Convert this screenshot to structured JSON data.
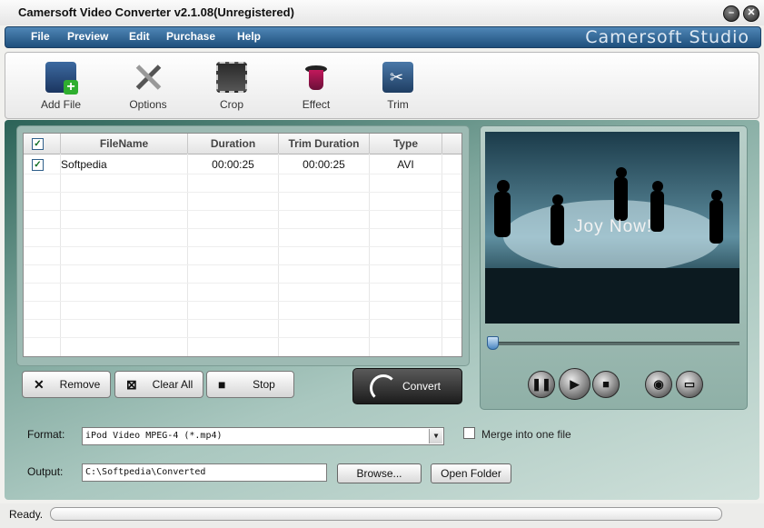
{
  "window": {
    "title": "Camersoft Video Converter v2.1.08(Unregistered)",
    "brand": "Camersoft Studio"
  },
  "menu": [
    "File",
    "Preview",
    "Edit",
    "Purchase",
    "Help"
  ],
  "toolbar": [
    {
      "label": "Add File",
      "icon": "film-add-icon"
    },
    {
      "label": "Options",
      "icon": "tools-icon"
    },
    {
      "label": "Crop",
      "icon": "crop-film-icon"
    },
    {
      "label": "Effect",
      "icon": "magic-hat-icon"
    },
    {
      "label": "Trim",
      "icon": "scissors-film-icon"
    }
  ],
  "filelist": {
    "columns": [
      "FileName",
      "Duration",
      "Trim Duration",
      "Type"
    ],
    "header_checked": true,
    "rows": [
      {
        "checked": true,
        "name": "Softpedia",
        "duration": "00:00:25",
        "trim": "00:00:25",
        "type": "AVI"
      }
    ]
  },
  "buttons": {
    "remove": "Remove",
    "clear_all": "Clear All",
    "stop": "Stop",
    "convert": "Convert"
  },
  "preview": {
    "overlay_text": "Joy Now!",
    "position_fraction": 0
  },
  "format": {
    "label": "Format:",
    "value": "iPod Video MPEG-4 (*.mp4)",
    "merge_label": "Merge into one file",
    "merge_checked": false
  },
  "output": {
    "label": "Output:",
    "value": "C:\\Softpedia\\Converted",
    "browse": "Browse...",
    "open_folder": "Open Folder"
  },
  "status": {
    "text": "Ready.",
    "progress": 0
  }
}
